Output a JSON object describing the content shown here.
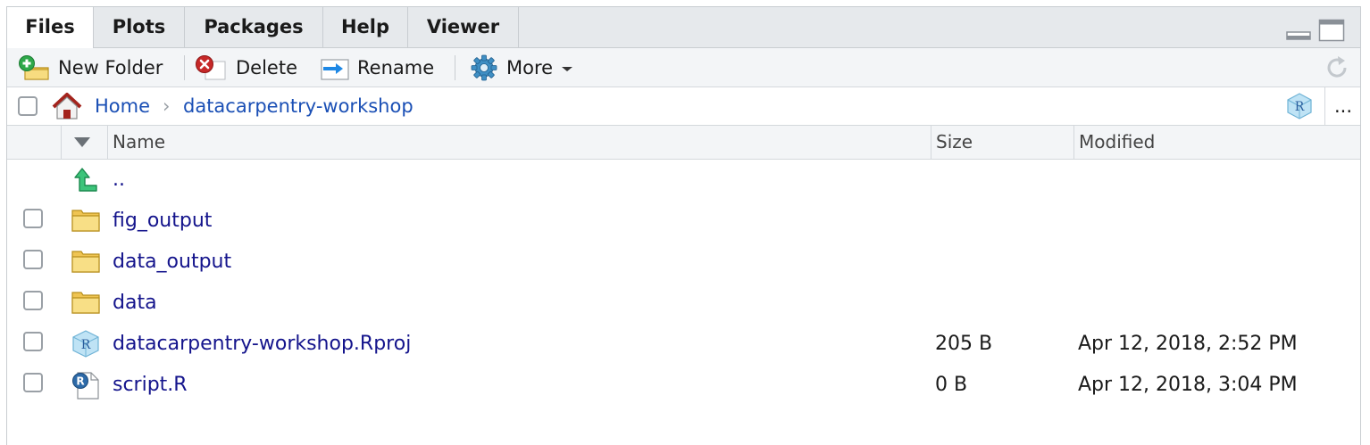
{
  "tabs": [
    {
      "label": "Files",
      "active": true
    },
    {
      "label": "Plots",
      "active": false
    },
    {
      "label": "Packages",
      "active": false
    },
    {
      "label": "Help",
      "active": false
    },
    {
      "label": "Viewer",
      "active": false
    }
  ],
  "toolbar": {
    "new_folder": "New Folder",
    "delete": "Delete",
    "rename": "Rename",
    "more": "More"
  },
  "breadcrumb": {
    "home": "Home",
    "separator": "›",
    "current": "datacarpentry-workshop",
    "overflow": "..."
  },
  "columns": {
    "name": "Name",
    "size": "Size",
    "modified": "Modified"
  },
  "rows": [
    {
      "name": "..",
      "type": "parent-dir",
      "icon": "up-arrow-icon",
      "size": "",
      "modified": ""
    },
    {
      "name": "fig_output",
      "type": "folder",
      "icon": "folder-icon",
      "size": "",
      "modified": ""
    },
    {
      "name": "data_output",
      "type": "folder",
      "icon": "folder-icon",
      "size": "",
      "modified": ""
    },
    {
      "name": "data",
      "type": "folder",
      "icon": "folder-icon",
      "size": "",
      "modified": ""
    },
    {
      "name": "datacarpentry-workshop.Rproj",
      "type": "rproj",
      "icon": "rproj-icon",
      "size": "205 B",
      "modified": "Apr 12, 2018, 2:52 PM"
    },
    {
      "name": "script.R",
      "type": "r-script",
      "icon": "r-script-icon",
      "size": "0 B",
      "modified": "Apr 12, 2018, 3:04 PM"
    }
  ],
  "colors": {
    "link": "#1a4fb5",
    "file_link": "#14148c",
    "toolbar_bg": "#f3f5f7",
    "tabbar_bg": "#e6e9ec"
  }
}
